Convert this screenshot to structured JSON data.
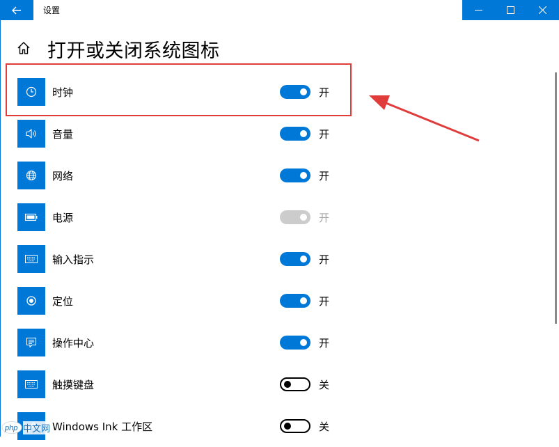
{
  "window": {
    "app_title": "设置",
    "controls": {
      "minimize": "—",
      "maximize": "☐",
      "close": "✕"
    },
    "accent": "#0078d7"
  },
  "page": {
    "title": "打开或关闭系统图标"
  },
  "items": [
    {
      "label": "时钟",
      "state": "开",
      "icon": "clock-icon",
      "status": "on"
    },
    {
      "label": "音量",
      "state": "开",
      "icon": "volume-icon",
      "status": "on"
    },
    {
      "label": "网络",
      "state": "开",
      "icon": "network-globe-icon",
      "status": "on"
    },
    {
      "label": "电源",
      "state": "开",
      "icon": "battery-icon",
      "status": "disabled"
    },
    {
      "label": "输入指示",
      "state": "开",
      "icon": "keyboard-icon",
      "status": "on"
    },
    {
      "label": "定位",
      "state": "开",
      "icon": "location-icon",
      "status": "on"
    },
    {
      "label": "操作中心",
      "state": "开",
      "icon": "action-center-icon",
      "status": "on"
    },
    {
      "label": "触摸键盘",
      "state": "关",
      "icon": "touch-keyboard-icon",
      "status": "off"
    },
    {
      "label": "Windows Ink 工作区",
      "state": "关",
      "icon": "windows-ink-icon",
      "status": "off"
    }
  ],
  "annotation": {
    "color": "#e03c3c"
  },
  "watermark": {
    "brand": "php",
    "site": "中文网"
  }
}
